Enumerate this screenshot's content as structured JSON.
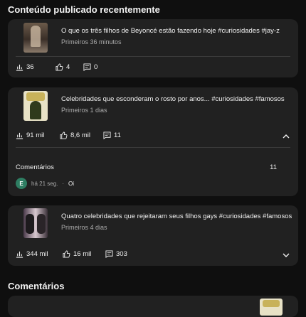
{
  "recent": {
    "title": "Conteúdo publicado recentemente",
    "videos": [
      {
        "title": "O que os três filhos de Beyoncé estão fazendo hoje #curiosidades #jay-z",
        "subtitle": "Primeiros 36 minutos",
        "views": "36",
        "likes": "4",
        "comments": "0"
      },
      {
        "title": "Celebridades que esconderam o rosto por anos... #curiosidades #famosos",
        "subtitle": "Primeiros 1 dias",
        "views": "91 mil",
        "likes": "8,6 mil",
        "comments": "11",
        "expanded": {
          "label": "Comentários",
          "count": "11",
          "comment": {
            "avatar": "E",
            "time": "há 21 seg.",
            "separator": "·",
            "text": "Oi"
          }
        }
      },
      {
        "title": "Quatro celebridades que rejeitaram seus filhos gays #curiosidades #famosos",
        "subtitle": "Primeiros 4 dias",
        "views": "344 mil",
        "likes": "16 mil",
        "comments": "303"
      }
    ]
  },
  "comments_section": {
    "title": "Comentários"
  },
  "icons": {
    "views": "bar-chart-icon",
    "likes": "thumbs-up-icon",
    "comments": "comment-icon",
    "collapse": "chevron-up-icon",
    "expand": "chevron-down-icon"
  },
  "colors": {
    "background": "#0f0f0f",
    "card": "#212121",
    "avatar": "#2e7d62"
  }
}
